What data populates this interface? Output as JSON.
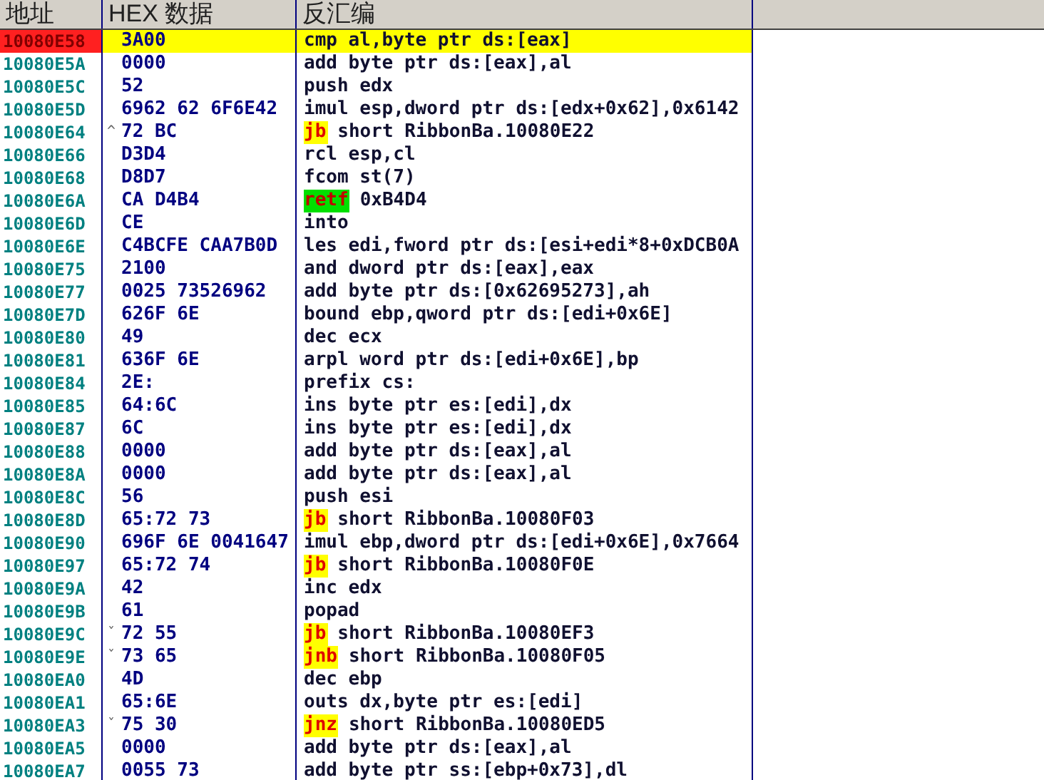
{
  "table": {
    "columns": [
      "地址",
      "HEX 数据",
      "反汇编"
    ],
    "rows": [
      {
        "address": "10080E58",
        "hex": "3A00",
        "instruction": "cmp al,byte ptr ds:[eax]",
        "selected": true
      },
      {
        "address": "10080E5A",
        "hex": "0000",
        "instruction": "add byte ptr ds:[eax],al",
        "selected": false
      },
      {
        "address": "10080E5C",
        "hex": "52",
        "instruction": "push edx",
        "selected": false
      },
      {
        "address": "10080E5D",
        "hex": "6962 62 6F6E42",
        "instruction": "imul esp,dword ptr ds:[edx+0x62],0x6142",
        "selected": false
      },
      {
        "address": "10080E64",
        "hex": "72 BC",
        "jump_mark": "^",
        "mnemonic": "jb",
        "kind": "jump",
        "instruction": "short RibbonBa.10080E22",
        "selected": false
      },
      {
        "address": "10080E66",
        "hex": "D3D4",
        "instruction": "rcl esp,cl",
        "selected": false
      },
      {
        "address": "10080E68",
        "hex": "D8D7",
        "instruction": "fcom st(7)",
        "selected": false
      },
      {
        "address": "10080E6A",
        "hex": "CA D4B4",
        "mnemonic": "retf",
        "kind": "return",
        "instruction": "0xB4D4",
        "selected": false
      },
      {
        "address": "10080E6D",
        "hex": "CE",
        "instruction": "into",
        "selected": false
      },
      {
        "address": "10080E6E",
        "hex": "C4BCFE CAA7B0D",
        "instruction": "les edi,fword ptr ds:[esi+edi*8+0xDCB0A",
        "selected": false
      },
      {
        "address": "10080E75",
        "hex": "2100",
        "instruction": "and dword ptr ds:[eax],eax",
        "selected": false
      },
      {
        "address": "10080E77",
        "hex": "0025 73526962",
        "instruction": "add byte ptr ds:[0x62695273],ah",
        "selected": false
      },
      {
        "address": "10080E7D",
        "hex": "626F 6E",
        "instruction": "bound ebp,qword ptr ds:[edi+0x6E]",
        "selected": false
      },
      {
        "address": "10080E80",
        "hex": "49",
        "instruction": "dec ecx",
        "selected": false
      },
      {
        "address": "10080E81",
        "hex": "636F 6E",
        "instruction": "arpl word ptr ds:[edi+0x6E],bp",
        "selected": false
      },
      {
        "address": "10080E84",
        "hex": "2E:",
        "instruction": "prefix cs:",
        "selected": false
      },
      {
        "address": "10080E85",
        "hex": "64:6C",
        "instruction": "ins byte ptr es:[edi],dx",
        "selected": false
      },
      {
        "address": "10080E87",
        "hex": "6C",
        "instruction": "ins byte ptr es:[edi],dx",
        "selected": false
      },
      {
        "address": "10080E88",
        "hex": "0000",
        "instruction": "add byte ptr ds:[eax],al",
        "selected": false
      },
      {
        "address": "10080E8A",
        "hex": "0000",
        "instruction": "add byte ptr ds:[eax],al",
        "selected": false
      },
      {
        "address": "10080E8C",
        "hex": "56",
        "instruction": "push esi",
        "selected": false
      },
      {
        "address": "10080E8D",
        "hex": "65:72 73",
        "mnemonic": "jb",
        "kind": "jump",
        "instruction": "short RibbonBa.10080F03",
        "selected": false
      },
      {
        "address": "10080E90",
        "hex": "696F 6E 0041647",
        "instruction": "imul ebp,dword ptr ds:[edi+0x6E],0x7664",
        "selected": false
      },
      {
        "address": "10080E97",
        "hex": "65:72 74",
        "mnemonic": "jb",
        "kind": "jump",
        "instruction": "short RibbonBa.10080F0E",
        "selected": false
      },
      {
        "address": "10080E9A",
        "hex": "42",
        "instruction": "inc edx",
        "selected": false
      },
      {
        "address": "10080E9B",
        "hex": "61",
        "instruction": "popad",
        "selected": false
      },
      {
        "address": "10080E9C",
        "hex": "72 55",
        "jump_mark": "ˇ",
        "mnemonic": "jb",
        "kind": "jump",
        "instruction": "short RibbonBa.10080EF3",
        "selected": false
      },
      {
        "address": "10080E9E",
        "hex": "73 65",
        "jump_mark": "ˇ",
        "mnemonic": "jnb",
        "kind": "jump",
        "instruction": "short RibbonBa.10080F05",
        "selected": false
      },
      {
        "address": "10080EA0",
        "hex": "4D",
        "instruction": "dec ebp",
        "selected": false
      },
      {
        "address": "10080EA1",
        "hex": "65:6E",
        "instruction": "outs dx,byte ptr es:[edi]",
        "selected": false
      },
      {
        "address": "10080EA3",
        "hex": "75 30",
        "jump_mark": "ˇ",
        "mnemonic": "jnz",
        "kind": "jump",
        "instruction": "short RibbonBa.10080ED5",
        "selected": false
      },
      {
        "address": "10080EA5",
        "hex": "0000",
        "instruction": "add byte ptr ds:[eax],al",
        "selected": false
      },
      {
        "address": "10080EA7",
        "hex": "0055 73",
        "instruction": "add byte ptr ss:[ebp+0x73],dl",
        "selected": false
      }
    ]
  }
}
